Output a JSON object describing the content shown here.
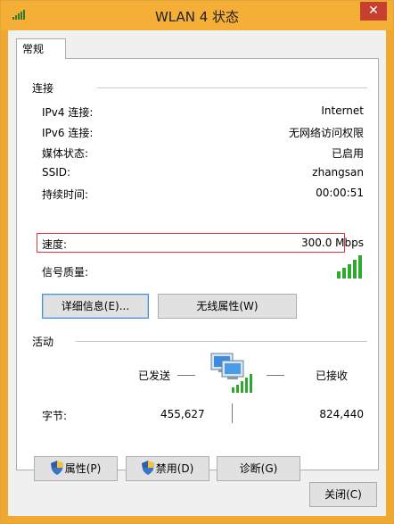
{
  "window": {
    "title": "WLAN 4 状态",
    "close_glyph": "✕"
  },
  "tabs": [
    {
      "label": "常规"
    }
  ],
  "connection": {
    "section_title": "连接",
    "rows": [
      {
        "label": "IPv4 连接:",
        "value": "Internet"
      },
      {
        "label": "IPv6 连接:",
        "value": "无网络访问权限"
      },
      {
        "label": "媒体状态:",
        "value": "已启用"
      },
      {
        "label": "SSID:",
        "value": "zhangsan"
      },
      {
        "label": "持续时间:",
        "value": "00:00:51"
      },
      {
        "label": "速度:",
        "value": "300.0 Mbps"
      }
    ],
    "signal_label": "信号质量:",
    "signal_bars": 5,
    "details_button": "详细信息(E)...",
    "wireless_button": "无线属性(W)"
  },
  "activity": {
    "section_title": "活动",
    "sent_label": "已发送",
    "received_label": "已接收",
    "bytes_label": "字节:",
    "sent_bytes": "455,627",
    "received_bytes": "824,440"
  },
  "actions": {
    "properties_button": "属性(P)",
    "disable_button": "禁用(D)",
    "diagnose_button": "诊断(G)",
    "close_button": "关闭(C)"
  },
  "colors": {
    "titlebar": "#f5ae36",
    "close": "#c7402f",
    "signal": "#2fa82f",
    "highlight": "#d93a3a"
  }
}
